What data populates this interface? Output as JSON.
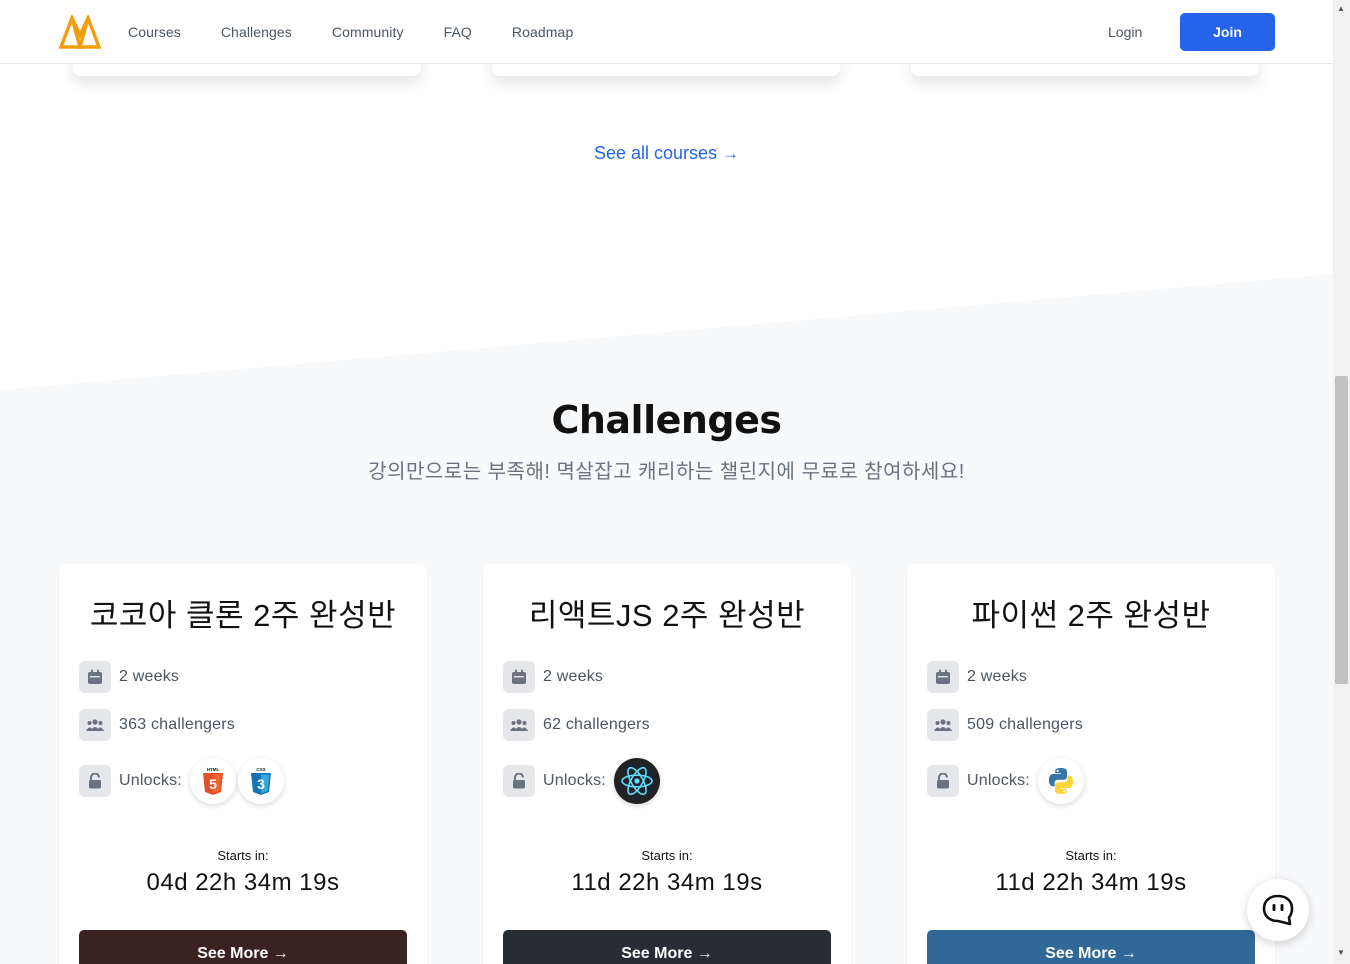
{
  "header": {
    "logo": "nomad-logo",
    "nav": [
      "Courses",
      "Challenges",
      "Community",
      "FAQ",
      "Roadmap"
    ],
    "login_label": "Login",
    "join_label": "Join"
  },
  "courses_link": {
    "label": "See all courses",
    "arrow": "→"
  },
  "challenges_section": {
    "title": "Challenges",
    "subtitle": "강의만으로는 부족해! 멱살잡고 캐리하는 챌린지에 무료로 참여하세요!",
    "unlocks_label": "Unlocks:",
    "starts_label": "Starts in:",
    "cards": [
      {
        "title": "코코아 클론 2주 완성반",
        "duration": "2 weeks",
        "challengers": "363 challengers",
        "unlocks": [
          "html5-icon",
          "css3-icon"
        ],
        "countdown": "04d 22h 34m 19s",
        "button_label": "See More →",
        "button_color": "#3a2220"
      },
      {
        "title": "리액트JS 2주 완성반",
        "duration": "2 weeks",
        "challengers": "62 challengers",
        "unlocks": [
          "react-icon"
        ],
        "countdown": "11d 22h 34m 19s",
        "button_label": "See More →",
        "button_color": "#282c34"
      },
      {
        "title": "파이썬 2주 완성반",
        "duration": "2 weeks",
        "challengers": "509 challengers",
        "unlocks": [
          "python-icon"
        ],
        "countdown": "11d 22h 34m 19s",
        "button_label": "See More →",
        "button_color": "#306998"
      }
    ]
  },
  "colors": {
    "accent": "#2563eb",
    "section_bg": "#f8f9fb",
    "logo": "#f59e0b"
  }
}
